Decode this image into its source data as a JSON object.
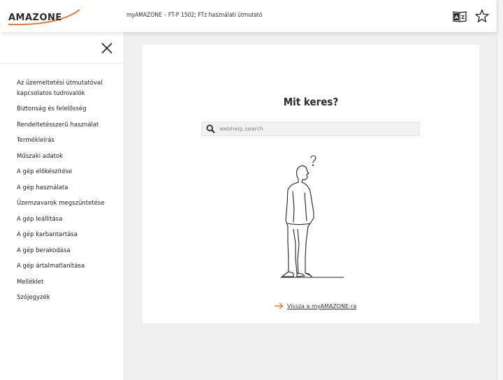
{
  "header": {
    "logo_text": "AMAZONE",
    "breadcrumb": [
      "myAMAZONE",
      "FT-P 1502; FTz használati útmutató"
    ],
    "breadcrumb_sep": "›"
  },
  "sidebar": {
    "items": [
      {
        "label": "Az üzemeltetési útmutatóval kapcsolatos tudnivalók"
      },
      {
        "label": "Biztonság és felelősség"
      },
      {
        "label": "Rendeltetésszerű használat"
      },
      {
        "label": "Termékleírás"
      },
      {
        "label": "Műszaki adatok"
      },
      {
        "label": "A gép előkészítése"
      },
      {
        "label": "A gép használata"
      },
      {
        "label": "Üzemzavarok megszüntetése"
      },
      {
        "label": "A gép leállítása"
      },
      {
        "label": "A gép karbantartása"
      },
      {
        "label": "A gép berakodása"
      },
      {
        "label": "A gép ártalmatlanítása"
      },
      {
        "label": "Melléklet"
      },
      {
        "label": "Szójegyzék"
      }
    ]
  },
  "main": {
    "title": "Mit keres?",
    "search_placeholder": "webhelp.search",
    "back_link": "Vissza a myAMAZONE-ra"
  },
  "colors": {
    "accent": "#e8742a",
    "text": "#222222",
    "background": "#f0f0f0"
  },
  "icons": {
    "dictionary": "dictionary-icon",
    "favorite": "star-icon",
    "close": "close-icon",
    "search": "search-icon",
    "back": "arrow-right-icon"
  }
}
